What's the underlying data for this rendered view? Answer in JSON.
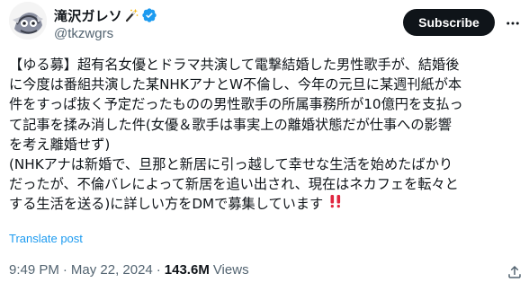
{
  "author": {
    "display_name": "滝沢ガレソ",
    "name_emoji": "magic-wand-icon",
    "handle": "@tkzwgrs",
    "verified": true
  },
  "actions": {
    "subscribe_label": "Subscribe",
    "more_icon": "more-horizontal-icon"
  },
  "post": {
    "lines": [
      "【ゆる募】超有名女優とドラマ共演して電撃結婚した男性歌手が、結婚後",
      "に今度は番組共演した某NHKアナとW不倫し、今年の元旦に某週刊紙が本",
      "件をすっぱ抜く予定だったものの男性歌手の所属事務所が10億円を支払っ",
      "て記事を揉み消した件(女優＆歌手は事実上の離婚状態だが仕事への影響",
      "を考え離婚せず)",
      "(NHKアナは新婚で、旦那と新居に引っ越して幸せな生活を始めたばかり",
      "だったが、不倫バレによって新居を追い出され、現在はネカフェを転々と",
      "する生活を送る)に詳しい方をDMで募集しています"
    ],
    "trailing_emoji": "double-exclamation-icon",
    "translate_label": "Translate post"
  },
  "meta": {
    "time": "9:49 PM",
    "separator": "·",
    "date": "May 22, 2024",
    "views_count": "143.6M",
    "views_label": "Views"
  },
  "colors": {
    "text": "#0f1419",
    "secondary": "#536471",
    "link": "#1d9bf0",
    "verified": "#1d9bf0",
    "button_bg": "#0f1419",
    "emoji_red": "#e0263f"
  }
}
